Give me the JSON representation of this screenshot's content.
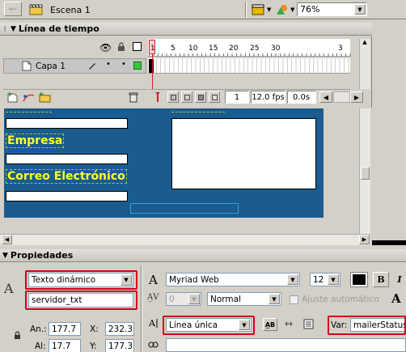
{
  "toolbar": {
    "scene_label": "Escena 1",
    "zoom_value": "76%"
  },
  "timeline": {
    "title": "Línea de tiempo",
    "layer_name": "Capa 1",
    "ticks": [
      "1",
      "5",
      "10",
      "15",
      "20",
      "25",
      "30",
      "3"
    ],
    "current_frame": "1",
    "fps": "12.0 fps",
    "elapsed": "0.0s"
  },
  "stage": {
    "labels": [
      "Empresa",
      "Correo Electrónico"
    ],
    "colors": {
      "background": "#1a5c8f",
      "label": "#ffff33"
    }
  },
  "properties": {
    "title": "Propiedades",
    "text_type": "Texto dinámico",
    "instance_name": "servidor_txt",
    "width_label": "An.:",
    "width_value": "177.7",
    "height_label": "Al:",
    "height_value": "17.7",
    "x_label": "X:",
    "x_value": "232.3",
    "y_label": "Y:",
    "y_value": "177.3",
    "font": "Myriad Web",
    "font_size": "12",
    "bold": "B",
    "italic": "I",
    "kerning_value": "0",
    "character_position": "Normal",
    "auto_adjust": "Ajuste automático",
    "line_type": "Línea única",
    "var_label": "Var:",
    "var_value": "mailerStatus"
  }
}
